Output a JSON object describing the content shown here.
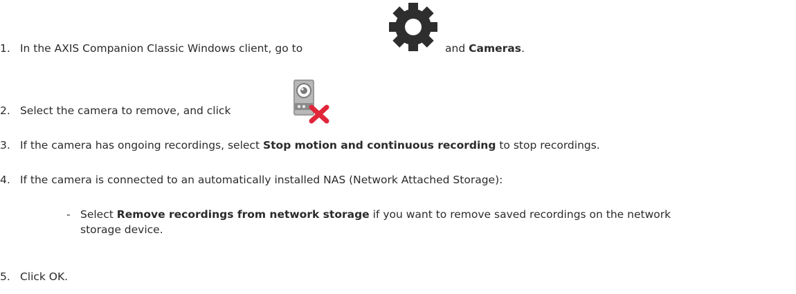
{
  "steps": [
    {
      "number": "1.",
      "text_before": "In the AXIS Companion Classic Windows client, go to",
      "text_middle": "and",
      "bold": "Cameras",
      "text_after": ".",
      "icon": "gear-icon"
    },
    {
      "number": "2.",
      "text_before": "Select the camera to remove, and click",
      "icon": "remove-camera-icon"
    },
    {
      "number": "3.",
      "text_before": "If the camera has ongoing recordings, select",
      "bold": "Stop motion and continuous recording",
      "text_after": "to stop recordings."
    },
    {
      "number": "4.",
      "text_before": "If the camera is connected to an automatically installed NAS (Network Attached Storage):",
      "sub_bullet": {
        "marker": "-",
        "text_before": "Select",
        "bold": "Remove recordings from network storage",
        "text_after": "if you want to remove saved recordings on the network",
        "text_line2": "storage device."
      }
    },
    {
      "number": "5.",
      "text_before": "Click OK."
    }
  ],
  "colors": {
    "text": "#2b2b2b",
    "gear": "#2e2e2e",
    "remove_x": "#e0263a",
    "camera_body": "#8f8f8f"
  }
}
